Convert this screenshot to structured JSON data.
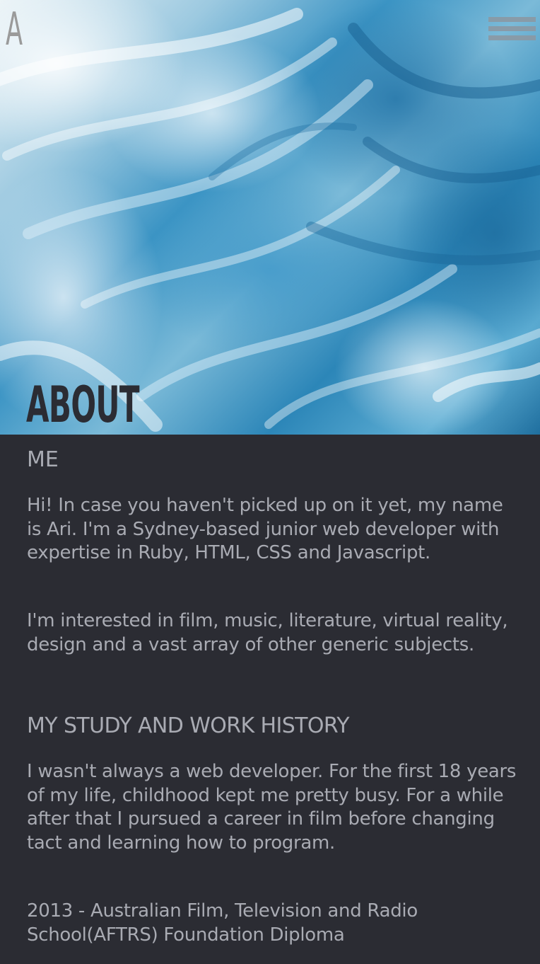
{
  "header": {
    "logo_text": "A",
    "menu_icon": "hamburger-menu-icon"
  },
  "hero": {
    "heading": "ABOUT"
  },
  "content": {
    "section_me_title": "ME",
    "intro_paragraph": "Hi! In case you haven't picked up on it yet, my name is Ari. I'm a Sydney-based junior web developer with expertise in Ruby, HTML, CSS and Javascript.",
    "interests_paragraph": "I'm interested in film, music, literature, virtual reality, design and a vast array of other generic subjects.",
    "section_history_title": "MY STUDY AND WORK HISTORY",
    "history_paragraph": "I wasn't always a web developer. For the first 18 years of my life, childhood kept me pretty busy. For a while after that I pursued a career in film before changing tact and learning how to program.",
    "education_entry": "2013 - Australian Film, Television and Radio School(AFTRS) Foundation Diploma"
  },
  "colors": {
    "background": "#2b2c33",
    "text": "#a9abb3",
    "heading_on_image": "#2b2c33",
    "menu_bars": "#8b98a3"
  }
}
